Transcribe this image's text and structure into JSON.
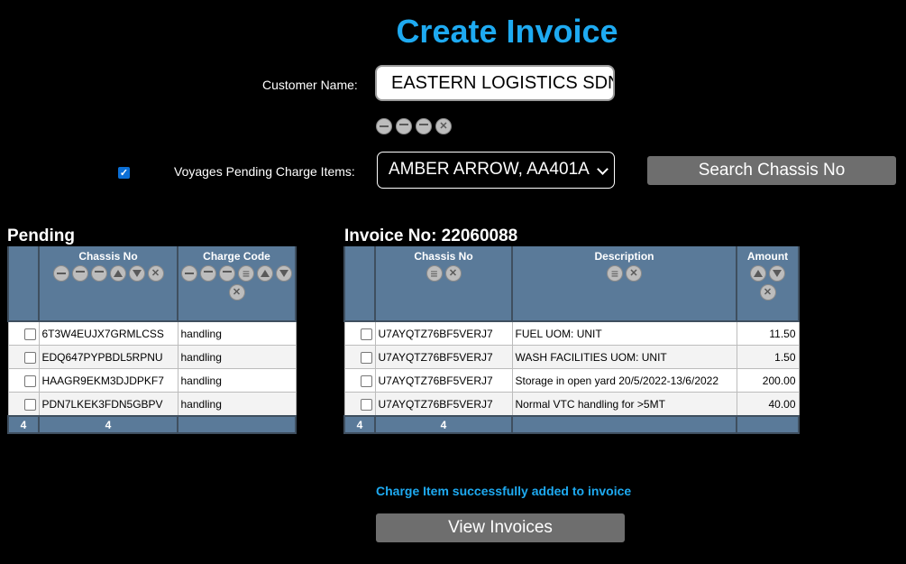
{
  "page": {
    "title": "Create Invoice"
  },
  "customer": {
    "label": "Customer Name:",
    "value": "EASTERN LOGISTICS SDN BHD"
  },
  "customer_icons": [
    "minus-icon",
    "minus-icon",
    "minus-icon",
    "close-icon"
  ],
  "voyages": {
    "label": "Voyages Pending Charge Items:",
    "selected": "AMBER ARROW, AA401A",
    "checked": true
  },
  "search_button": {
    "label": "Search Chassis No"
  },
  "pending": {
    "title": "Pending",
    "columns": [
      "Chassis No",
      "Charge Code"
    ],
    "rows": [
      {
        "chassis": "6T3W4EUJX7GRMLCSS",
        "code": "handling"
      },
      {
        "chassis": "EDQ647PYPBDL5RPNU",
        "code": "handling"
      },
      {
        "chassis": "HAAGR9EKM3DJDPKF7",
        "code": "handling"
      },
      {
        "chassis": "PDN7LKEK3FDN5GBPV",
        "code": "handling"
      }
    ],
    "footer": {
      "count": "4",
      "chassis_count": "4"
    }
  },
  "invoice": {
    "title": "Invoice No: 22060088",
    "columns": [
      "Chassis No",
      "Description",
      "Amount"
    ],
    "rows": [
      {
        "chassis": "U7AYQTZ76BF5VERJ7",
        "description": "FUEL UOM: UNIT",
        "amount": "11.50"
      },
      {
        "chassis": "U7AYQTZ76BF5VERJ7",
        "description": "WASH FACILITIES UOM: UNIT",
        "amount": "1.50"
      },
      {
        "chassis": "U7AYQTZ76BF5VERJ7",
        "description": "Storage in open yard 20/5/2022-13/6/2022",
        "amount": "200.00"
      },
      {
        "chassis": "U7AYQTZ76BF5VERJ7",
        "description": "Normal VTC handling for >5MT",
        "amount": "40.00"
      }
    ],
    "footer": {
      "count": "4",
      "chassis_count": "4"
    }
  },
  "status_message": "Charge Item successfully added to invoice",
  "view_button": {
    "label": "View Invoices"
  },
  "colors": {
    "accent": "#1eaaf1",
    "grid_header": "#5a7a99",
    "button": "#6e6e6e"
  }
}
